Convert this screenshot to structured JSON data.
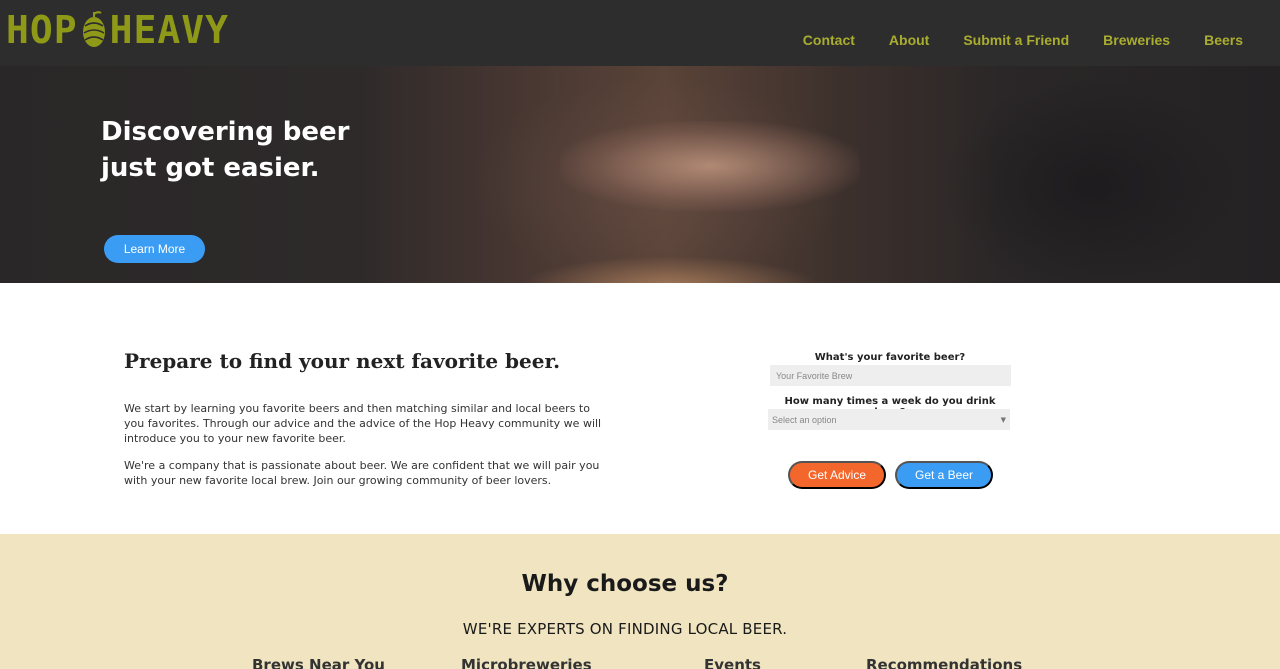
{
  "header": {
    "logo_left": "HOP",
    "logo_right": "HEAVY",
    "nav": [
      "Contact",
      "About",
      "Submit a Friend",
      "Breweries",
      "Beers"
    ]
  },
  "hero": {
    "title_line1": "Discovering beer",
    "title_line2": "just got easier.",
    "button": "Learn More"
  },
  "intro": {
    "title": "Prepare to find your next favorite beer.",
    "p1": "We start by learning you favorite beers and then matching similar and local beers to you favorites. Through our advice and the advice of the Hop Heavy community we will introduce you to your new favorite beer.",
    "p2": "We're a company that is passionate about beer. We are confident that we will pair you with your new favorite local brew. Join our growing community of beer lovers."
  },
  "form": {
    "label1": "What's your favorite beer?",
    "placeholder1": "Your Favorite Brew",
    "label2": "How many times a week do you drink beer?",
    "select_value": "Select an option",
    "btn_advice": "Get Advice",
    "btn_beer": "Get a Beer"
  },
  "why": {
    "title": "Why choose us?",
    "subtitle": "WE'RE EXPERTS ON FINDING LOCAL BEER.",
    "features": [
      "Brews Near You",
      "Microbreweries",
      "Events",
      "Recommendations"
    ]
  },
  "colors": {
    "header_bg": "#2e2d2e",
    "logo": "#8e9a17",
    "nav": "#a9ad2f",
    "blue": "#3b9cf4",
    "orange": "#f4672c",
    "cream": "#f0e5c0"
  }
}
